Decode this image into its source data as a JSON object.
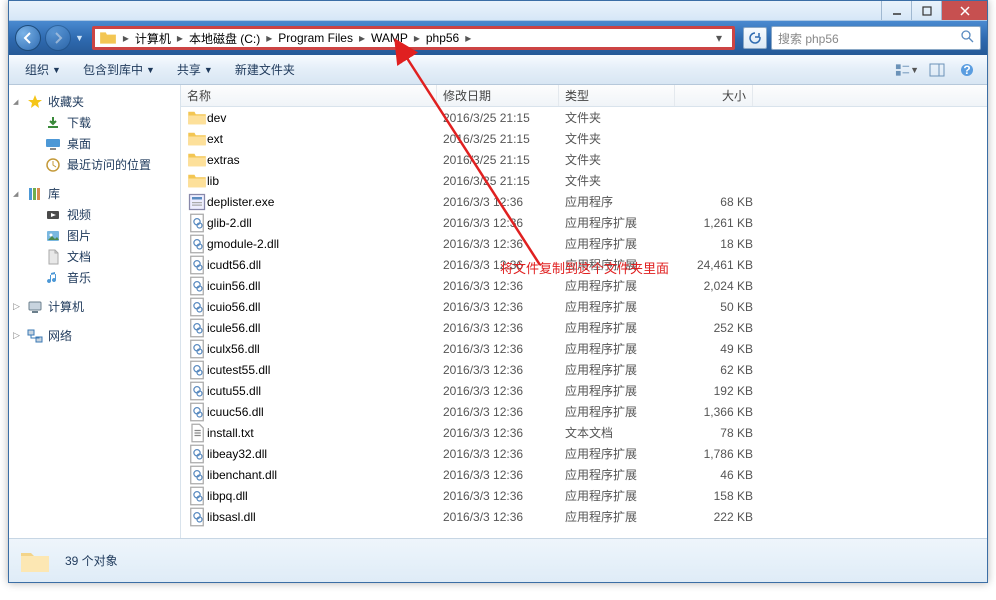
{
  "window": {
    "min": "—",
    "max": "□",
    "close": "✕"
  },
  "nav": {
    "crumbs": [
      "计算机",
      "本地磁盘 (C:)",
      "Program Files",
      "WAMP",
      "php56"
    ],
    "search_placeholder": "搜索 php56"
  },
  "toolbar": {
    "organize": "组织",
    "include": "包含到库中",
    "share": "共享",
    "newfolder": "新建文件夹"
  },
  "sidebar": {
    "favorites": {
      "label": "收藏夹",
      "items": [
        "下载",
        "桌面",
        "最近访问的位置"
      ]
    },
    "libraries": {
      "label": "库",
      "items": [
        "视频",
        "图片",
        "文档",
        "音乐"
      ]
    },
    "computer": {
      "label": "计算机"
    },
    "network": {
      "label": "网络"
    }
  },
  "columns": {
    "name": "名称",
    "date": "修改日期",
    "type": "类型",
    "size": "大小"
  },
  "filetypes": {
    "folder": "文件夹",
    "app": "应用程序",
    "ext": "应用程序扩展",
    "txt": "文本文档"
  },
  "files": [
    {
      "icon": "folder",
      "name": "dev",
      "date": "2016/3/25 21:15",
      "type": "folder",
      "size": ""
    },
    {
      "icon": "folder",
      "name": "ext",
      "date": "2016/3/25 21:15",
      "type": "folder",
      "size": ""
    },
    {
      "icon": "folder",
      "name": "extras",
      "date": "2016/3/25 21:15",
      "type": "folder",
      "size": ""
    },
    {
      "icon": "folder",
      "name": "lib",
      "date": "2016/3/25 21:15",
      "type": "folder",
      "size": ""
    },
    {
      "icon": "exe",
      "name": "deplister.exe",
      "date": "2016/3/3 12:36",
      "type": "app",
      "size": "68 KB"
    },
    {
      "icon": "dll",
      "name": "glib-2.dll",
      "date": "2016/3/3 12:36",
      "type": "ext",
      "size": "1,261 KB"
    },
    {
      "icon": "dll",
      "name": "gmodule-2.dll",
      "date": "2016/3/3 12:36",
      "type": "ext",
      "size": "18 KB"
    },
    {
      "icon": "dll",
      "name": "icudt56.dll",
      "date": "2016/3/3 12:36",
      "type": "ext",
      "size": "24,461 KB"
    },
    {
      "icon": "dll",
      "name": "icuin56.dll",
      "date": "2016/3/3 12:36",
      "type": "ext",
      "size": "2,024 KB"
    },
    {
      "icon": "dll",
      "name": "icuio56.dll",
      "date": "2016/3/3 12:36",
      "type": "ext",
      "size": "50 KB"
    },
    {
      "icon": "dll",
      "name": "icule56.dll",
      "date": "2016/3/3 12:36",
      "type": "ext",
      "size": "252 KB"
    },
    {
      "icon": "dll",
      "name": "iculx56.dll",
      "date": "2016/3/3 12:36",
      "type": "ext",
      "size": "49 KB"
    },
    {
      "icon": "dll",
      "name": "icutest55.dll",
      "date": "2016/3/3 12:36",
      "type": "ext",
      "size": "62 KB"
    },
    {
      "icon": "dll",
      "name": "icutu55.dll",
      "date": "2016/3/3 12:36",
      "type": "ext",
      "size": "192 KB"
    },
    {
      "icon": "dll",
      "name": "icuuc56.dll",
      "date": "2016/3/3 12:36",
      "type": "ext",
      "size": "1,366 KB"
    },
    {
      "icon": "txt",
      "name": "install.txt",
      "date": "2016/3/3 12:36",
      "type": "txt",
      "size": "78 KB"
    },
    {
      "icon": "dll",
      "name": "libeay32.dll",
      "date": "2016/3/3 12:36",
      "type": "ext",
      "size": "1,786 KB"
    },
    {
      "icon": "dll",
      "name": "libenchant.dll",
      "date": "2016/3/3 12:36",
      "type": "ext",
      "size": "46 KB"
    },
    {
      "icon": "dll",
      "name": "libpq.dll",
      "date": "2016/3/3 12:36",
      "type": "ext",
      "size": "158 KB"
    },
    {
      "icon": "dll",
      "name": "libsasl.dll",
      "date": "2016/3/3 12:36",
      "type": "ext",
      "size": "222 KB"
    }
  ],
  "status": {
    "count": "39 个对象"
  },
  "annotation": {
    "text": "将文件复制到这个文件夹里面"
  }
}
